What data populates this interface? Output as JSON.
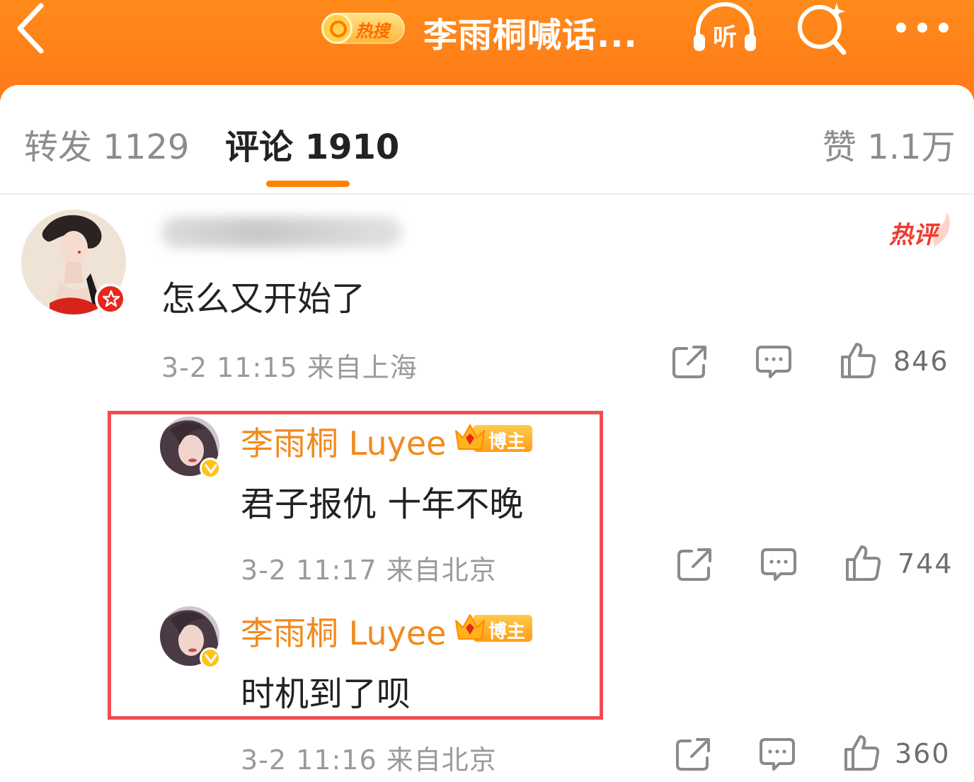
{
  "header": {
    "hot_badge_label": "热搜",
    "title": "李雨桐喊话...",
    "listen_label": "听"
  },
  "tabs": [
    {
      "label": "转发 1129"
    },
    {
      "label": "评论 1910"
    },
    {
      "label": "赞 1.1万"
    }
  ],
  "comments": {
    "main": {
      "hot_tag": "热评",
      "text": "怎么又开始了",
      "meta": "3-2 11:15  来自上海",
      "likes": "846"
    },
    "replies": [
      {
        "author": "李雨桐 Luyee",
        "badge": "博主",
        "text": "君子报仇 十年不晚",
        "meta": "3-2 11:17  来自北京",
        "likes": "744"
      },
      {
        "author": "李雨桐 Luyee",
        "badge": "博主",
        "text": "时机到了呗",
        "meta": "3-2 11:16  来自北京",
        "likes": "360"
      }
    ]
  },
  "colors": {
    "header_orange": "#ff7a18",
    "accent_orange": "#ff8200",
    "author_orange": "#f28a1e",
    "highlight_red": "#f24c52",
    "hot_red": "#f23a2e"
  },
  "icons": [
    "back-arrow-icon",
    "hot-search-icon",
    "headphones-icon",
    "search-sparkle-icon",
    "more-dots-icon",
    "share-icon",
    "comment-icon",
    "thumbs-up-icon",
    "crown-icon",
    "verified-icon",
    "vip-star-icon"
  ]
}
